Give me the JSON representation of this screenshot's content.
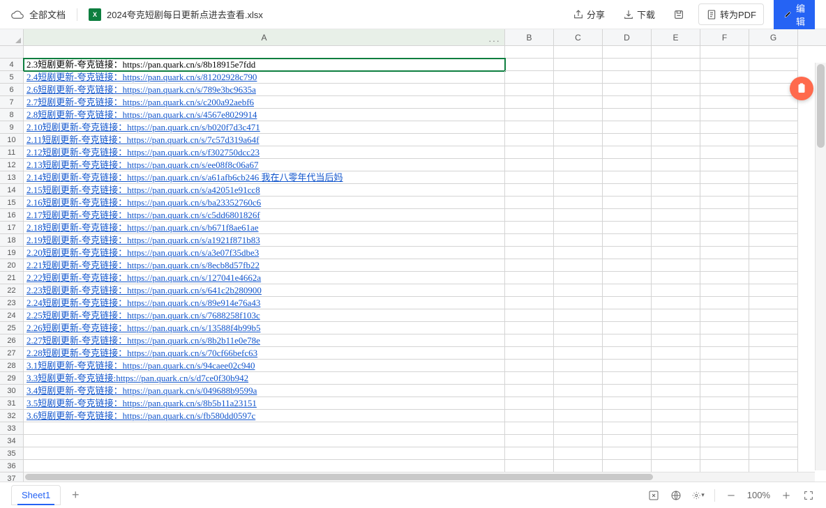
{
  "topbar": {
    "all_docs": "全部文档",
    "filename": "2024夸克短剧每日更新点进去查看.xlsx",
    "share": "分享",
    "download": "下载",
    "pdf": "转为PDF",
    "edit": "编辑"
  },
  "columns": [
    "A",
    "B",
    "C",
    "D",
    "E",
    "F",
    "G"
  ],
  "rows": [
    {
      "n": "",
      "text": "",
      "link": false
    },
    {
      "n": "4",
      "text": "2.3短剧更新-夸克链接：https://pan.quark.cn/s/8b18915e7fdd",
      "link": false,
      "sel": true
    },
    {
      "n": "5",
      "text": "2.4短剧更新-夸克链接：https://pan.quark.cn/s/81202928c790",
      "link": true
    },
    {
      "n": "6",
      "text": "2.6短剧更新-夸克链接：https://pan.quark.cn/s/789e3bc9635a",
      "link": true
    },
    {
      "n": "7",
      "text": "2.7短剧更新-夸克链接：https://pan.quark.cn/s/c200a92aebf6",
      "link": true
    },
    {
      "n": "8",
      "text": "2.8短剧更新-夸克链接：https://pan.quark.cn/s/4567e8029914",
      "link": true
    },
    {
      "n": "9",
      "text": "2.10短剧更新-夸克链接：https://pan.quark.cn/s/b020f7d3c471",
      "link": true
    },
    {
      "n": "10",
      "text": "2.11短剧更新-夸克链接：https://pan.quark.cn/s/7c57d319a64f",
      "link": true
    },
    {
      "n": "11",
      "text": "2.12短剧更新-夸克链接：https://pan.quark.cn/s/f302750dcc23",
      "link": true
    },
    {
      "n": "12",
      "text": "2.13短剧更新-夸克链接：https://pan.quark.cn/s/ee08f8c06a67",
      "link": true
    },
    {
      "n": "13",
      "text": "2.14短剧更新-夸克链接：https://pan.quark.cn/s/a61afb6cb246  我在八零年代当后妈",
      "link": true
    },
    {
      "n": "14",
      "text": "2.15短剧更新-夸克链接：https://pan.quark.cn/s/a42051e91cc8",
      "link": true
    },
    {
      "n": "15",
      "text": "2.16短剧更新-夸克链接：https://pan.quark.cn/s/ba23352760c6",
      "link": true
    },
    {
      "n": "16",
      "text": "2.17短剧更新-夸克链接：https://pan.quark.cn/s/c5dd6801826f",
      "link": true
    },
    {
      "n": "17",
      "text": "2.18短剧更新-夸克链接：https://pan.quark.cn/s/b671f8ae61ae",
      "link": true
    },
    {
      "n": "18",
      "text": "2.19短剧更新-夸克链接：https://pan.quark.cn/s/a1921f871b83",
      "link": true
    },
    {
      "n": "19",
      "text": "2.20短剧更新-夸克链接：https://pan.quark.cn/s/a3e07f35dbe3",
      "link": true
    },
    {
      "n": "20",
      "text": "2.21短剧更新-夸克链接：https://pan.quark.cn/s/8ecb8d57fb22",
      "link": true
    },
    {
      "n": "21",
      "text": "2.22短剧更新-夸克链接：https://pan.quark.cn/s/127041e4662a",
      "link": true
    },
    {
      "n": "22",
      "text": "2.23短剧更新-夸克链接：https://pan.quark.cn/s/641c2b280900",
      "link": true
    },
    {
      "n": "23",
      "text": "2.24短剧更新-夸克链接：https://pan.quark.cn/s/89e914e76a43",
      "link": true
    },
    {
      "n": "24",
      "text": "2.25短剧更新-夸克链接：https://pan.quark.cn/s/7688258f103c",
      "link": true
    },
    {
      "n": "25",
      "text": "2.26短剧更新-夸克链接：https://pan.quark.cn/s/13588f4b99b5",
      "link": true
    },
    {
      "n": "26",
      "text": "2.27短剧更新-夸克链接：https://pan.quark.cn/s/8b2b11e0e78e",
      "link": true
    },
    {
      "n": "27",
      "text": "2.28短剧更新-夸克链接：https://pan.quark.cn/s/70cf66befc63",
      "link": true
    },
    {
      "n": "28",
      "text": "3.1短剧更新-夸克链接：https://pan.quark.cn/s/94caee02c940",
      "link": true
    },
    {
      "n": "29",
      "text": "3.3短剧更新-夸克链接:https://pan.quark.cn/s/d7ce0f30b942",
      "link": true
    },
    {
      "n": "30",
      "text": "3.4短剧更新-夸克链接：https://pan.quark.cn/s/049688b9599a",
      "link": true
    },
    {
      "n": "31",
      "text": "3.5短剧更新-夸克链接：https://pan.quark.cn/s/8b5b11a23151",
      "link": true
    },
    {
      "n": "32",
      "text": "3.6短剧更新-夸克链接：https://pan.quark.cn/s/fb580dd0597c",
      "link": true
    },
    {
      "n": "33",
      "text": "",
      "link": false
    },
    {
      "n": "34",
      "text": "",
      "link": false
    },
    {
      "n": "35",
      "text": "",
      "link": false
    },
    {
      "n": "36",
      "text": "",
      "link": false
    },
    {
      "n": "37",
      "text": "",
      "link": false
    }
  ],
  "bottom": {
    "sheet": "Sheet1",
    "zoom": "100%"
  }
}
